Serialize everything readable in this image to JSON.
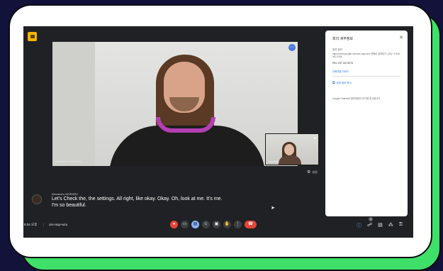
{
  "meeting": {
    "main_participant": "Alexandru MORARU",
    "self_participant": "Lea Gex",
    "settings_label": "설정",
    "time": "5:34 오후",
    "separator": "|",
    "code": "ois-nsqv-wzu"
  },
  "caption": {
    "speaker": "Alexandru MORARU",
    "line1": "Let's Check the, the settings. All right, like okay. Okay. Oh, look at me. It's me.",
    "line2": "I'm so beautiful."
  },
  "panel": {
    "title": "회의 세부정보",
    "close_icon": "✕",
    "join_info_label": "참여 정보",
    "join_url": "https://meet.google.com/ois-nsqv-wzu 전화로 참여하기: (US) +1 544-410-0346",
    "pin": "PIN: 237 210 5274",
    "more_numbers": "전화번호 더보기",
    "attachments": "참여 정보 복사",
    "calendar_note": "Google Calendar 첨부파일이 여기에 표시됩니다."
  },
  "controls": {
    "people_count": "4"
  },
  "colors": {
    "meet_bg": "#202124",
    "accent_blue": "#8ab4f8",
    "end_red": "#ea4335",
    "frame_green": "#3fe06a"
  }
}
